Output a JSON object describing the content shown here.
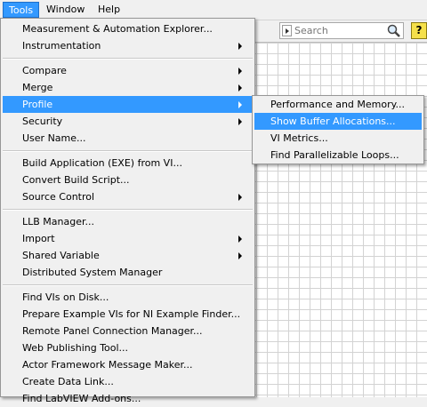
{
  "menubar": {
    "items": [
      {
        "label": "Tools"
      },
      {
        "label": "Window"
      },
      {
        "label": "Help"
      }
    ]
  },
  "toolbar": {
    "search_placeholder": "Search",
    "search_icon": "magnifier-icon",
    "help_icon": "help-icon",
    "help_glyph": "?"
  },
  "tools_menu": {
    "items": [
      {
        "label": "Measurement & Automation Explorer..."
      },
      {
        "label": "Instrumentation"
      },
      {
        "label": "Compare"
      },
      {
        "label": "Merge"
      },
      {
        "label": "Profile"
      },
      {
        "label": "Security"
      },
      {
        "label": "User Name..."
      },
      {
        "label": "Build Application (EXE) from VI..."
      },
      {
        "label": "Convert Build Script..."
      },
      {
        "label": "Source Control"
      },
      {
        "label": "LLB Manager..."
      },
      {
        "label": "Import"
      },
      {
        "label": "Shared Variable"
      },
      {
        "label": "Distributed System Manager"
      },
      {
        "label": "Find VIs on Disk..."
      },
      {
        "label": "Prepare Example VIs for NI Example Finder..."
      },
      {
        "label": "Remote Panel Connection Manager..."
      },
      {
        "label": "Web Publishing Tool..."
      },
      {
        "label": "Actor Framework Message Maker..."
      },
      {
        "label": "Create Data Link..."
      },
      {
        "label": "Find LabVIEW Add-ons..."
      }
    ]
  },
  "profile_submenu": {
    "items": [
      {
        "label": "Performance and Memory..."
      },
      {
        "label": "Show Buffer Allocations..."
      },
      {
        "label": "VI Metrics..."
      },
      {
        "label": "Find Parallelizable Loops..."
      }
    ]
  },
  "colors": {
    "highlight": "#3399ff",
    "menu_bg": "#f0f0f0",
    "grid_line": "#d3d3d3"
  }
}
